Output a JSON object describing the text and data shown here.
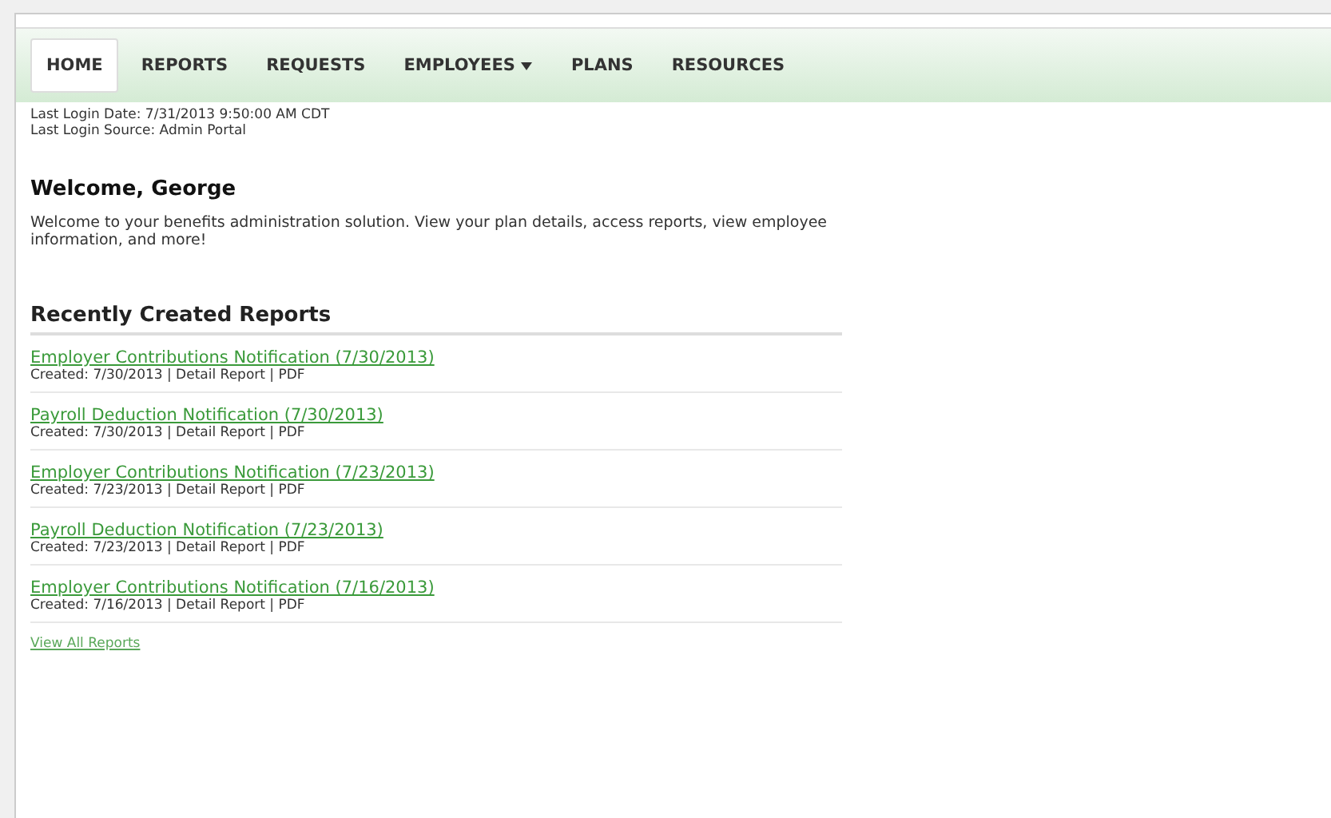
{
  "nav": [
    {
      "label": "HOME",
      "selected": true,
      "dropdown": false
    },
    {
      "label": "REPORTS",
      "selected": false,
      "dropdown": false
    },
    {
      "label": "REQUESTS",
      "selected": false,
      "dropdown": false
    },
    {
      "label": "EMPLOYEES",
      "selected": false,
      "dropdown": true
    },
    {
      "label": "PLANS",
      "selected": false,
      "dropdown": false
    },
    {
      "label": "RESOURCES",
      "selected": false,
      "dropdown": false
    }
  ],
  "login": [
    "Last Login Date: 7/31/2013 9:50:00 AM CDT",
    "Last Login Source: Admin Portal"
  ],
  "welcome": {
    "title": "Welcome, George",
    "text": "Welcome to your benefits administration solution. View your plan details, access reports, view employee information, and more!"
  },
  "reports": {
    "title": "Recently Created Reports",
    "items": [
      {
        "link": "Employer Contributions Notification (7/30/2013)",
        "meta": "Created: 7/30/2013 | Detail Report | PDF"
      },
      {
        "link": "Payroll Deduction Notification (7/30/2013)",
        "meta": "Created: 7/30/2013 | Detail Report | PDF"
      },
      {
        "link": "Employer Contributions Notification (7/23/2013)",
        "meta": "Created: 7/23/2013 | Detail Report | PDF"
      },
      {
        "link": "Payroll Deduction Notification (7/23/2013)",
        "meta": "Created: 7/23/2013 | Detail Report | PDF"
      },
      {
        "link": "Employer Contributions Notification (7/16/2013)",
        "meta": "Created: 7/16/2013 | Detail Report | PDF"
      }
    ],
    "view_all": "View All Reports"
  }
}
